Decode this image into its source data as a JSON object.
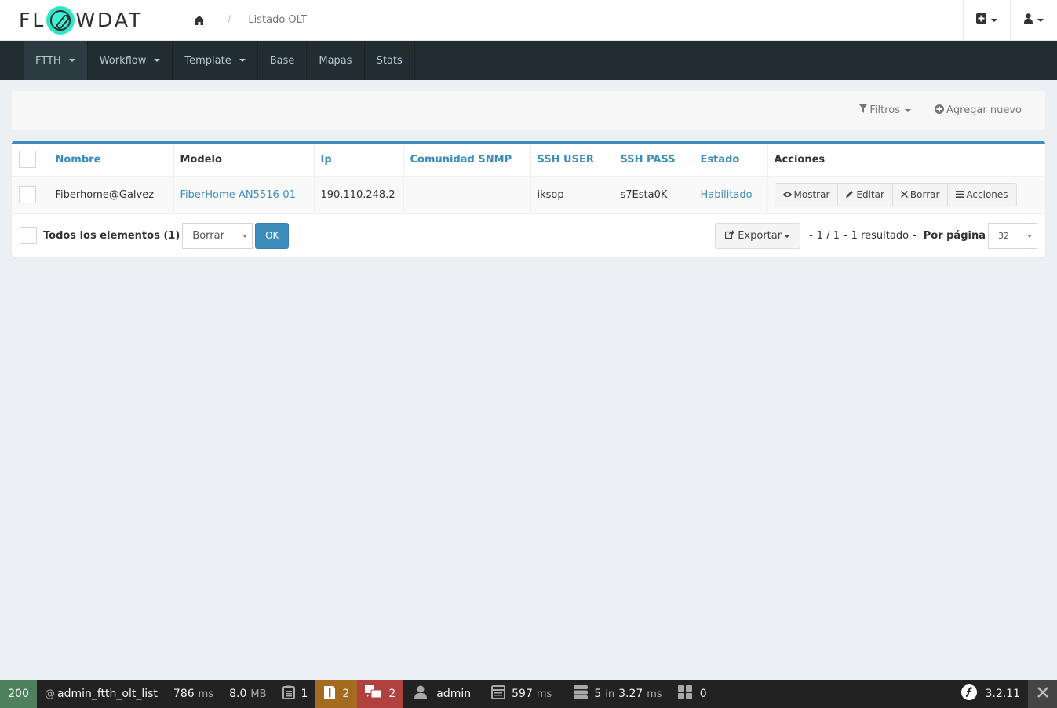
{
  "header": {
    "logo_left": "FL",
    "logo_right": "WDAT",
    "breadcrumb_current": "Listado OLT",
    "breadcrumb_separator": "/"
  },
  "nav": {
    "items": [
      {
        "label": "FTTH",
        "dropdown": true,
        "active": true
      },
      {
        "label": "Workflow",
        "dropdown": true
      },
      {
        "label": "Template",
        "dropdown": true
      },
      {
        "label": "Base"
      },
      {
        "label": "Mapas"
      },
      {
        "label": "Stats"
      }
    ]
  },
  "filters": {
    "filters_label": "Filtros",
    "add_new_label": "Agregar nuevo"
  },
  "table": {
    "columns": [
      "Nombre",
      "Modelo",
      "Ip",
      "Comunidad SNMP",
      "SSH USER",
      "SSH PASS",
      "Estado",
      "Acciones"
    ],
    "rows": [
      {
        "nombre": "Fiberhome@Galvez",
        "modelo": "FiberHome-AN5516-01",
        "ip": "190.110.248.2",
        "comunidad": "",
        "ssh_user": "iksop",
        "ssh_pass": "s7Esta0K",
        "estado": "Habilitado"
      }
    ],
    "actions": {
      "show": "Mostrar",
      "edit": "Editar",
      "delete": "Borrar",
      "more": "Acciones"
    }
  },
  "footer": {
    "all_elements": "Todos los elementos (1)",
    "batch_action": "Borrar",
    "ok": "OK",
    "export": "Exportar",
    "pages": "1 / 1",
    "results": "1 resultado",
    "dash": "-",
    "per_page_label": "Por página",
    "per_page_value": "32"
  },
  "debugbar": {
    "status": "200",
    "route": "admin_ftth_olt_list",
    "time_value": "786",
    "time_unit": "ms",
    "memory_value": "8.0",
    "memory_unit": "MB",
    "logs": "1",
    "warnings": "2",
    "translations": "2",
    "user": "admin",
    "render_value": "597",
    "render_unit": "ms",
    "db_queries": "5",
    "db_in": "in",
    "db_time": "3.27",
    "db_unit": "ms",
    "twig": "0",
    "version": "3.2.11"
  },
  "colors": {
    "primary": "#3c8dbc",
    "nav_bg": "#222d32",
    "accent": "#2ee6c7"
  }
}
